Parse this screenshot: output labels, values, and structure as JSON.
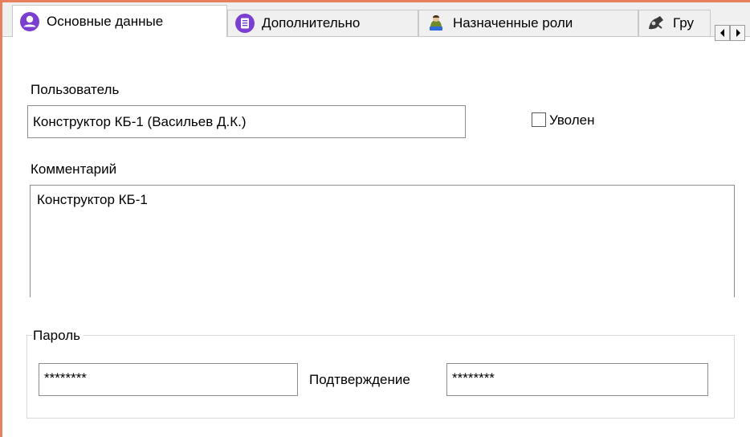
{
  "tabs": [
    {
      "label": "Основные данные",
      "icon": "user-icon",
      "active": true
    },
    {
      "label": "Дополнительно",
      "icon": "document-icon",
      "active": false
    },
    {
      "label": "Назначенные роли",
      "icon": "roles-icon",
      "active": false
    },
    {
      "label": "Гру",
      "icon": "groups-icon",
      "active": false
    }
  ],
  "user": {
    "label": "Пользователь",
    "value": "Конструктор КБ-1 (Васильев Д.К.)"
  },
  "fired": {
    "label": "Уволен",
    "checked": false
  },
  "comment": {
    "label": "Комментарий",
    "value": "Конструктор КБ-1"
  },
  "password": {
    "group_label": "Пароль",
    "value": "********",
    "confirm_label": "Подтверждение",
    "confirm_value": "********"
  },
  "colors": {
    "frame": "#e7805e",
    "user_icon": "#7b3fd0",
    "document_icon": "#7b3fd0"
  }
}
